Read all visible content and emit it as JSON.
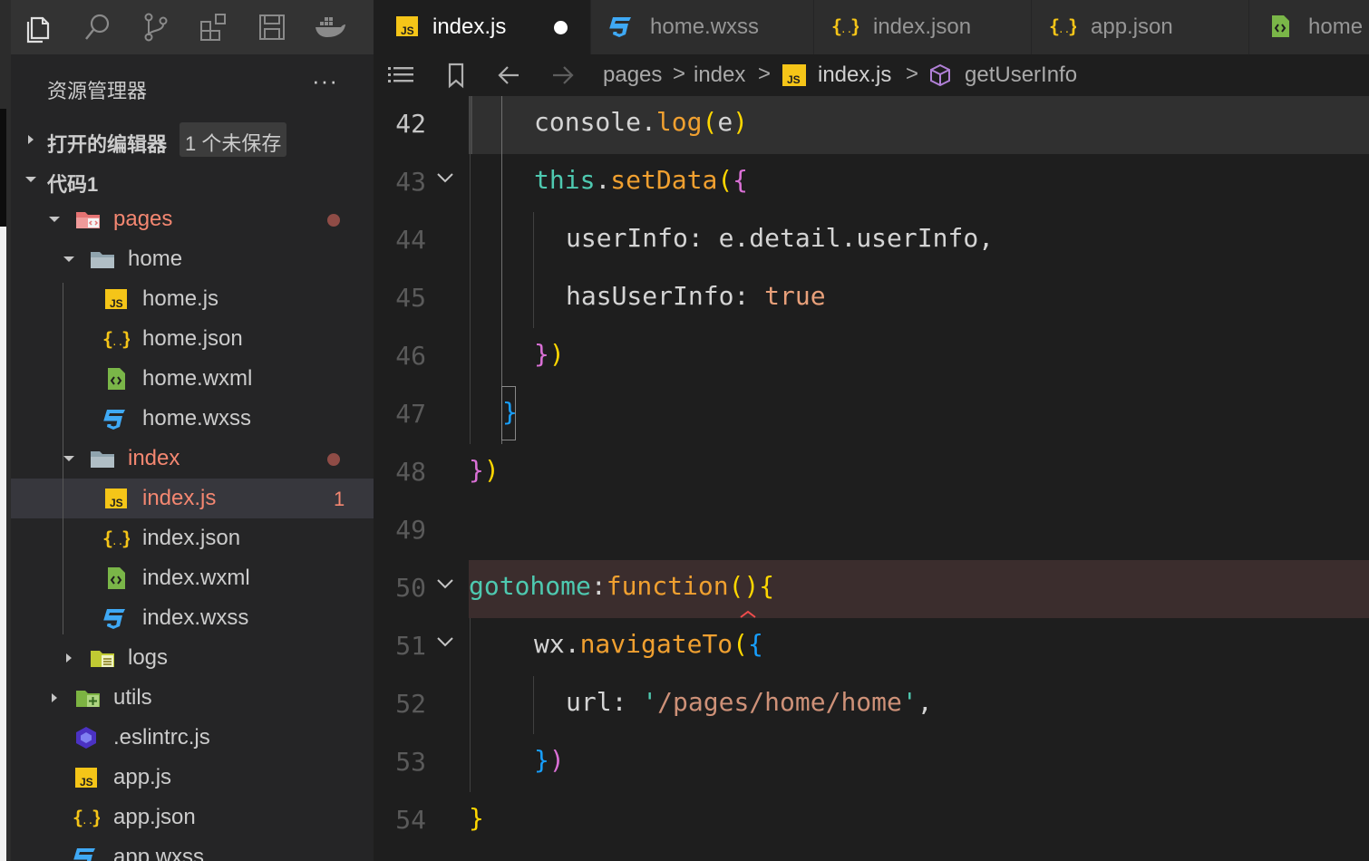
{
  "toolbar": {
    "icons": [
      "files-icon",
      "search-icon",
      "source-control-icon",
      "extensions-icon",
      "save-icon",
      "docker-icon"
    ]
  },
  "sidebar": {
    "title": "资源管理器",
    "more": "···",
    "open_editors": {
      "label": "打开的编辑器",
      "badge": "1 个未保存"
    },
    "workspace": {
      "label": "代码1"
    },
    "tree": [
      {
        "label": "pages",
        "kind": "folder-pages",
        "expanded": true,
        "modified": true
      },
      {
        "label": "home",
        "kind": "folder",
        "expanded": true
      },
      {
        "label": "home.js",
        "kind": "js"
      },
      {
        "label": "home.json",
        "kind": "json"
      },
      {
        "label": "home.wxml",
        "kind": "wxml"
      },
      {
        "label": "home.wxss",
        "kind": "wxss"
      },
      {
        "label": "index",
        "kind": "folder",
        "expanded": true,
        "modified": true
      },
      {
        "label": "index.js",
        "kind": "js",
        "selected": true,
        "problems": "1"
      },
      {
        "label": "index.json",
        "kind": "json"
      },
      {
        "label": "index.wxml",
        "kind": "wxml"
      },
      {
        "label": "index.wxss",
        "kind": "wxss"
      },
      {
        "label": "logs",
        "kind": "folder-logs",
        "expanded": false
      },
      {
        "label": "utils",
        "kind": "folder-utils",
        "expanded": false
      },
      {
        "label": ".eslintrc.js",
        "kind": "eslint"
      },
      {
        "label": "app.js",
        "kind": "js"
      },
      {
        "label": "app.json",
        "kind": "json"
      },
      {
        "label": "app.wxss",
        "kind": "wxss"
      }
    ]
  },
  "tabs": [
    {
      "label": "index.js",
      "kind": "js",
      "active": true,
      "unsaved": true
    },
    {
      "label": "home.wxss",
      "kind": "wxss"
    },
    {
      "label": "index.json",
      "kind": "json"
    },
    {
      "label": "app.json",
      "kind": "json"
    },
    {
      "label": "home",
      "kind": "wxml"
    }
  ],
  "breadcrumb": {
    "items": [
      "pages",
      "index",
      "index.js",
      "getUserInfo"
    ],
    "separator": ">"
  },
  "editor": {
    "lines": [
      {
        "n": "42",
        "current": true,
        "tokens": [
          [
            "console",
            "k-plain"
          ],
          [
            ".",
            "k-plain"
          ],
          [
            "log",
            "k-method"
          ],
          [
            "(",
            "k-yel"
          ],
          [
            "e",
            "k-plain"
          ],
          [
            ")",
            "k-yel"
          ]
        ]
      },
      {
        "n": "43",
        "fold": true,
        "tokens": [
          [
            "this",
            "k-teal"
          ],
          [
            ".",
            "k-plain"
          ],
          [
            "setData",
            "k-method"
          ],
          [
            "(",
            "k-yel"
          ],
          [
            "{",
            "k-pink"
          ]
        ]
      },
      {
        "n": "44",
        "tokens": [
          [
            "userInfo",
            "k-plain"
          ],
          [
            ": ",
            "k-plain"
          ],
          [
            "e",
            "k-plain"
          ],
          [
            ".",
            "k-plain"
          ],
          [
            "detail",
            "k-plain"
          ],
          [
            ".",
            "k-plain"
          ],
          [
            "userInfo",
            "k-plain"
          ],
          [
            ",",
            "k-plain"
          ]
        ]
      },
      {
        "n": "45",
        "tokens": [
          [
            "hasUserInfo",
            "k-plain"
          ],
          [
            ": ",
            "k-plain"
          ],
          [
            "true",
            "k-lit"
          ]
        ]
      },
      {
        "n": "46",
        "tokens": [
          [
            "}",
            "k-pink"
          ],
          [
            ")",
            "k-yel"
          ]
        ]
      },
      {
        "n": "47",
        "tokens": [
          [
            "}",
            "k-brk"
          ]
        ]
      },
      {
        "n": "48",
        "tokens": [
          [
            "}",
            "k-pink"
          ],
          [
            ")",
            "k-yel"
          ]
        ]
      },
      {
        "n": "49",
        "tokens": []
      },
      {
        "n": "50",
        "fold": true,
        "highlight": true,
        "tokens": [
          [
            "gotohome",
            "k-teal"
          ],
          [
            ":",
            "k-plain"
          ],
          [
            "function",
            "k-method"
          ],
          [
            "(",
            "k-yel"
          ],
          [
            ")",
            "k-yel"
          ],
          [
            "{",
            "k-yel"
          ]
        ]
      },
      {
        "n": "51",
        "fold": true,
        "tokens": [
          [
            "wx",
            "k-plain"
          ],
          [
            ".",
            "k-plain"
          ],
          [
            "navigateTo",
            "k-method"
          ],
          [
            "(",
            "k-yel"
          ],
          [
            "{",
            "k-brk"
          ]
        ]
      },
      {
        "n": "52",
        "tokens": [
          [
            "url",
            "k-plain"
          ],
          [
            ": ",
            "k-plain"
          ],
          [
            "'",
            "k-teal"
          ],
          [
            "/pages/home/home",
            "k-str"
          ],
          [
            "'",
            "k-teal"
          ],
          [
            ",",
            "k-plain"
          ]
        ]
      },
      {
        "n": "53",
        "tokens": [
          [
            "}",
            "k-brk"
          ],
          [
            ")",
            "k-pink"
          ]
        ]
      },
      {
        "n": "54",
        "tokens": [
          [
            "}",
            "k-yel"
          ]
        ]
      }
    ]
  },
  "colors": {
    "accent_modified": "#f48771",
    "dot_modified": "#8f4c46",
    "js_icon": "#f5c518",
    "json_icon": "#f5c518",
    "wxss_icon": "#3fa9f5",
    "wxml_icon": "#7ab648"
  }
}
